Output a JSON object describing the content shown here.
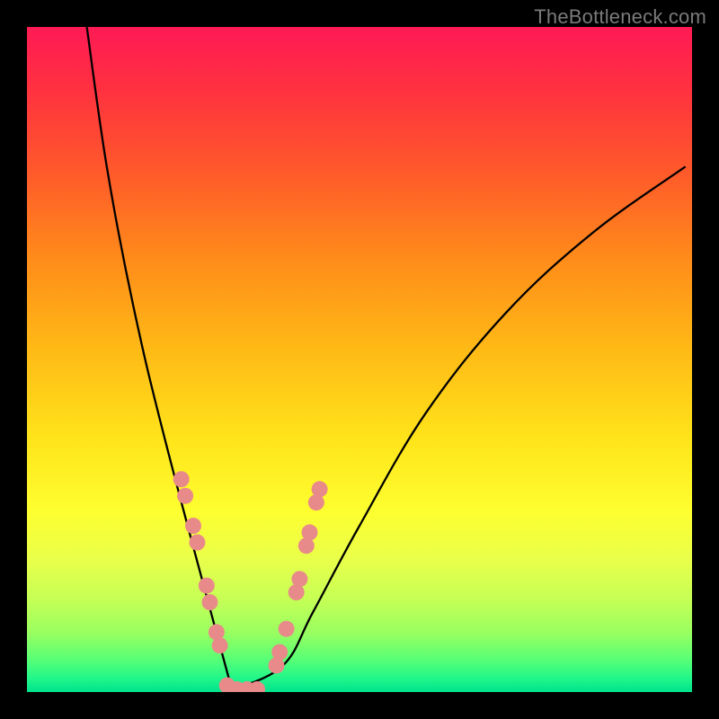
{
  "watermark": "TheBottleneck.com",
  "chart_data": {
    "type": "line",
    "title": "",
    "xlabel": "",
    "ylabel": "",
    "xlim": [
      0,
      100
    ],
    "ylim": [
      0,
      100
    ],
    "grid": false,
    "legend": false,
    "series": [
      {
        "name": "curve",
        "color": "#000000",
        "x": [
          9,
          12,
          16,
          21,
          30.1,
          30.95,
          30.95,
          38.5,
          43,
          50,
          60,
          72,
          85,
          99
        ],
        "values": [
          100,
          79,
          58,
          37,
          3,
          0.3,
          0.3,
          4,
          12,
          25,
          42,
          57,
          69,
          79
        ]
      }
    ],
    "markers": {
      "color": "#e88a8a",
      "radius": 9,
      "points": [
        {
          "x": 23.2,
          "y": 32.0
        },
        {
          "x": 23.8,
          "y": 29.5
        },
        {
          "x": 25.0,
          "y": 25.0
        },
        {
          "x": 25.6,
          "y": 22.5
        },
        {
          "x": 27.0,
          "y": 16.0
        },
        {
          "x": 27.5,
          "y": 13.5
        },
        {
          "x": 28.5,
          "y": 9.0
        },
        {
          "x": 29.0,
          "y": 7.0
        },
        {
          "x": 30.1,
          "y": 1.0
        },
        {
          "x": 31.6,
          "y": 0.4
        },
        {
          "x": 33.1,
          "y": 0.4
        },
        {
          "x": 34.6,
          "y": 0.4
        },
        {
          "x": 37.5,
          "y": 4.0
        },
        {
          "x": 38.0,
          "y": 6.0
        },
        {
          "x": 39.0,
          "y": 9.5
        },
        {
          "x": 40.5,
          "y": 15.0
        },
        {
          "x": 41.0,
          "y": 17.0
        },
        {
          "x": 42.0,
          "y": 22.0
        },
        {
          "x": 42.5,
          "y": 24.0
        },
        {
          "x": 43.5,
          "y": 28.5
        },
        {
          "x": 44.0,
          "y": 30.5
        }
      ]
    }
  }
}
